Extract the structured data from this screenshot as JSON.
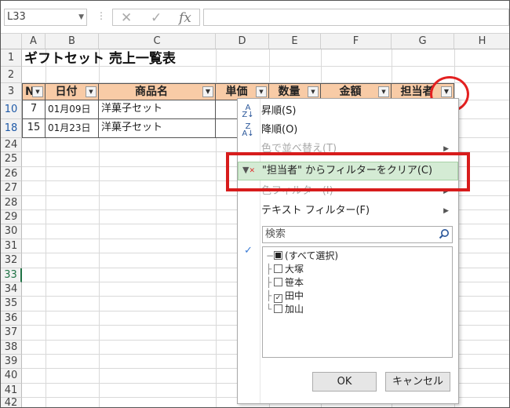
{
  "formula_bar": {
    "name_box": "L33",
    "cancel_icon": "✕",
    "enter_icon": "✓",
    "fx_label": "fx",
    "formula": ""
  },
  "columns": [
    "A",
    "B",
    "C",
    "D",
    "E",
    "F",
    "G",
    "H"
  ],
  "row_numbers": [
    "1",
    "2",
    "3",
    "10",
    "18",
    "24",
    "25",
    "26",
    "27",
    "28",
    "29",
    "30",
    "31",
    "32",
    "33",
    "34",
    "35",
    "36",
    "37",
    "38",
    "39",
    "40",
    "41",
    "42"
  ],
  "sheet": {
    "title": "ギフトセット 売上一覧表",
    "headers": [
      "N",
      "日付",
      "商品名",
      "単価",
      "数量",
      "金額",
      "担当者"
    ],
    "rows": [
      {
        "no": "7",
        "date": "01月09日",
        "product": "洋菓子セット"
      },
      {
        "no": "15",
        "date": "01月23日",
        "product": "洋菓子セット"
      }
    ]
  },
  "filter_menu": {
    "sort_asc": "昇順(S)",
    "sort_desc": "降順(O)",
    "sort_by_color": "色で並べ替え(T)",
    "clear_filter": "\"担当者\" からフィルターをクリア(C)",
    "color_filter": "色フィルター(I)",
    "text_filter": "テキスト フィルター(F)",
    "search_placeholder": "検索",
    "list": [
      {
        "label": "(すべて選択)",
        "state": "partial"
      },
      {
        "label": "大塚",
        "state": "unchecked"
      },
      {
        "label": "笹本",
        "state": "unchecked"
      },
      {
        "label": "田中",
        "state": "checked"
      },
      {
        "label": "加山",
        "state": "unchecked"
      }
    ],
    "ok": "OK",
    "cancel": "キャンセル"
  },
  "colors": {
    "header_fill": "#f8cba6",
    "highlight": "#d4ebd4",
    "annotation_red": "#d71c1c"
  }
}
